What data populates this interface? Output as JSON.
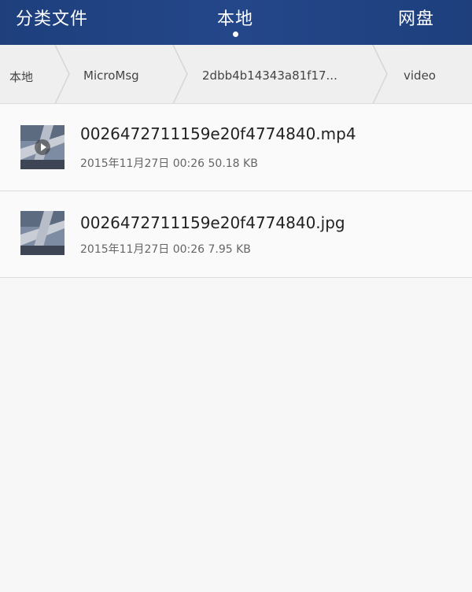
{
  "tabs": [
    {
      "label": "分类文件"
    },
    {
      "label": "本地"
    },
    {
      "label": "网盘"
    }
  ],
  "active_tab": "本地",
  "breadcrumb": [
    {
      "label": "本地"
    },
    {
      "label": "MicroMsg"
    },
    {
      "label": "2dbb4b14343a81f17..."
    },
    {
      "label": "video"
    }
  ],
  "files": [
    {
      "name": "0026472711159e20f4774840.mp4",
      "meta": "2015年11月27日 00:26 50.18 KB",
      "thumb_icon": "video-thumbnail"
    },
    {
      "name": "0026472711159e20f4774840.jpg",
      "meta": "2015年11月27日 00:26 7.95 KB",
      "thumb_icon": "image-thumbnail"
    }
  ],
  "colors": {
    "top_bar": "#1e3f7c",
    "breadcrumb_bg": "#efefef",
    "list_bg": "#fafafa"
  }
}
